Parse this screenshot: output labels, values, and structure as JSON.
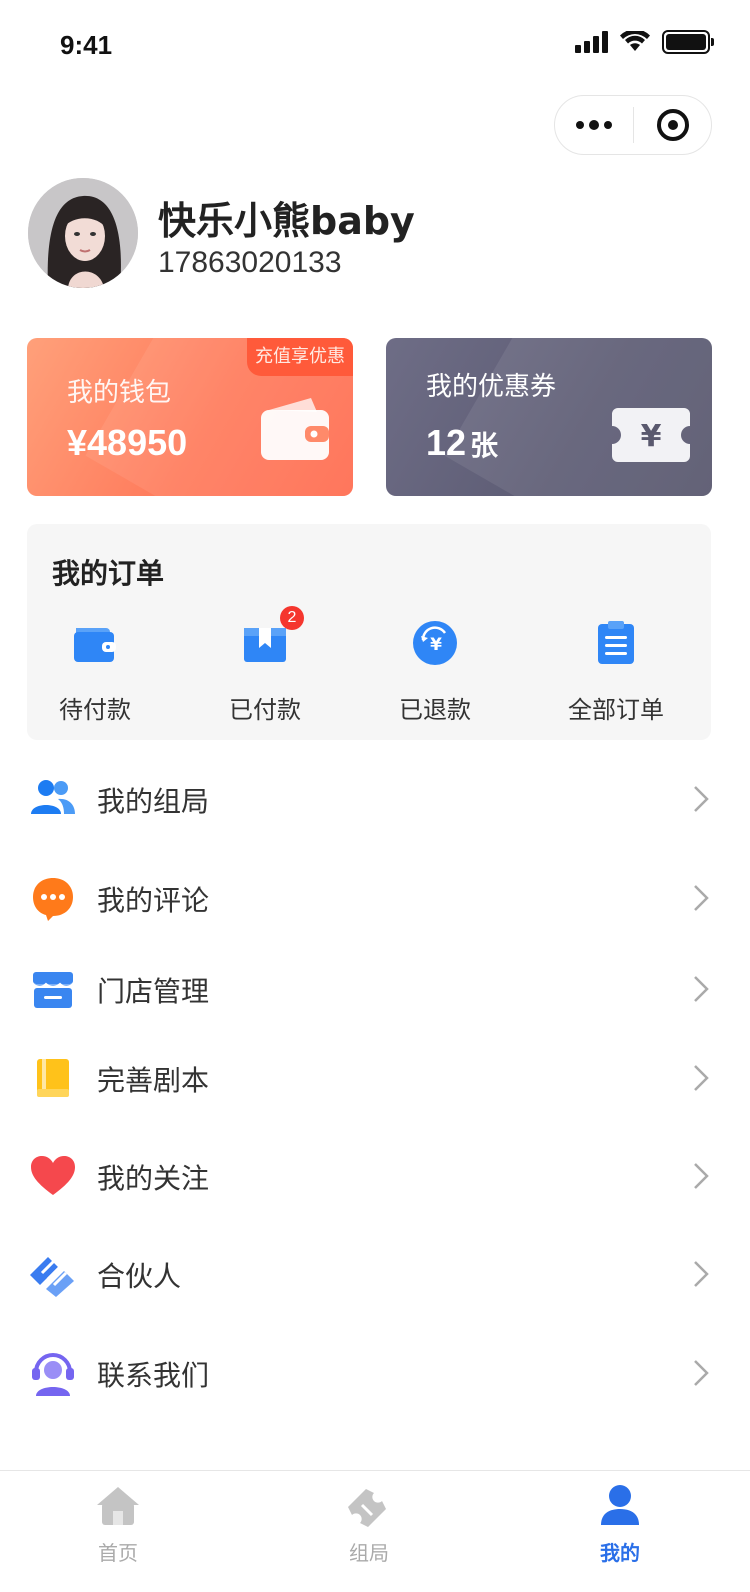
{
  "status_bar": {
    "time": "9:41"
  },
  "capsule": {
    "more_icon": "more-dots-icon",
    "close_icon": "target-circle-icon"
  },
  "profile": {
    "nickname": "快乐小熊baby",
    "phone": "17863020133"
  },
  "wallet": {
    "label": "我的钱包",
    "amount": "¥48950",
    "promo": "充值享优惠",
    "icon": "wallet-icon",
    "color": "#ff7b5c"
  },
  "coupon": {
    "label": "我的优惠券",
    "count": "12",
    "unit": "张",
    "icon": "ticket-yuan-icon",
    "color": "#5d5c74"
  },
  "orders": {
    "title": "我的订单",
    "items": [
      {
        "label": "待付款",
        "icon": "wallet-blue-icon"
      },
      {
        "label": "已付款",
        "icon": "box-icon",
        "badge": "2"
      },
      {
        "label": "已退款",
        "icon": "refund-yuan-icon"
      },
      {
        "label": "全部订单",
        "icon": "clipboard-icon"
      }
    ]
  },
  "menu": [
    {
      "label": "我的组局",
      "icon": "group-users-icon",
      "color": "#1d7cf2"
    },
    {
      "label": "我的评论",
      "icon": "comment-bubble-icon",
      "color": "#ff7a1a"
    },
    {
      "label": "门店管理",
      "icon": "store-icon",
      "color": "#3a86f0"
    },
    {
      "label": "完善剧本",
      "icon": "book-icon",
      "color": "#ffc21a"
    },
    {
      "label": "我的关注",
      "icon": "heart-icon",
      "color": "#f5484d"
    },
    {
      "label": "合伙人",
      "icon": "handshake-icon",
      "color": "#3a7cf0"
    },
    {
      "label": "联系我们",
      "icon": "customer-service-icon",
      "color": "#7565f0"
    }
  ],
  "tabbar": {
    "items": [
      {
        "label": "首页",
        "icon": "home-icon",
        "active": false
      },
      {
        "label": "组局",
        "icon": "ticket-tab-icon",
        "active": false
      },
      {
        "label": "我的",
        "icon": "user-icon",
        "active": true
      }
    ],
    "active_color": "#2a6fe8"
  }
}
